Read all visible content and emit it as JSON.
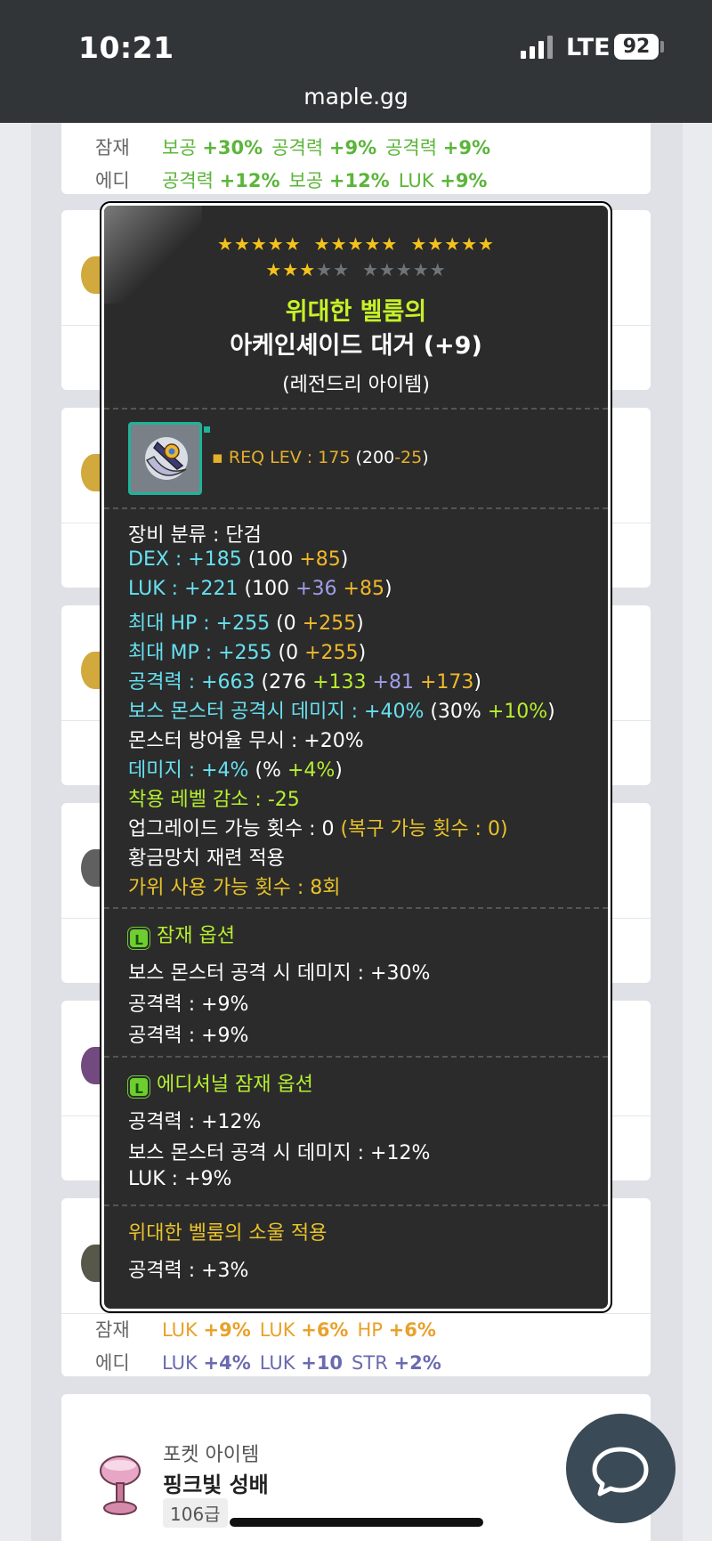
{
  "status": {
    "time": "10:21",
    "network": "LTE",
    "battery": "92"
  },
  "browser": {
    "url": "maple.gg"
  },
  "list": {
    "first_card": {
      "pot_label": "잠재",
      "pot": [
        {
          "k": "보공",
          "v": "+30%"
        },
        {
          "k": "공격력",
          "v": "+9%"
        },
        {
          "k": "공격력",
          "v": "+9%"
        }
      ],
      "add_label": "에디",
      "add": [
        {
          "k": "공격력",
          "v": "+12%"
        },
        {
          "k": "보공",
          "v": "+12%"
        },
        {
          "k": "LUK",
          "v": "+9%"
        }
      ]
    },
    "last_card": {
      "pot_label": "잠재",
      "pot": [
        {
          "k": "LUK",
          "v": "+9%"
        },
        {
          "k": "LUK",
          "v": "+6%"
        },
        {
          "k": "HP",
          "v": "+6%"
        }
      ],
      "add_label": "에디",
      "add": [
        {
          "k": "LUK",
          "v": "+4%"
        },
        {
          "k": "LUK",
          "v": "+10"
        },
        {
          "k": "STR",
          "v": "+2%"
        }
      ]
    },
    "pocket": {
      "category": "포켓 아이템",
      "name": "핑크빛 성배",
      "grade": "106급"
    }
  },
  "tooltip": {
    "stars_filled": 18,
    "stars_total": 25,
    "prefix": "위대한 벨룸의",
    "name": "아케인셰이드 대거 (+9)",
    "grade": "(레전드리 아이템)",
    "req": {
      "label": "▪ REQ LEV : 175 ",
      "open": "(",
      "base": "200",
      "reduce": "-25",
      "close": ")"
    },
    "stats": {
      "category": "장비 분류 : 단검",
      "dex": {
        "label": "DEX : +185",
        "paren_open": " (100 ",
        "add": "+85",
        "paren_close": ")"
      },
      "luk": {
        "label": "LUK : +221",
        "paren_open": " (100 ",
        "scroll": "+36",
        "add": "+85",
        "paren_close": ")"
      },
      "hp": {
        "label": "최대 HP : +255",
        "paren_open": " (0 ",
        "add": "+255",
        "paren_close": ")"
      },
      "mp": {
        "label": "최대 MP : +255",
        "paren_open": " (0 ",
        "add": "+255",
        "paren_close": ")"
      },
      "att": {
        "label": "공격력 : +663",
        "paren_open": " (276 ",
        "star": "+133",
        "scroll": "+81",
        "add": "+173",
        "paren_close": ")"
      },
      "boss": {
        "label": "보스 몬스터 공격시 데미지 : +40%",
        "paren_open": " (30% ",
        "add": "+10%",
        "paren_close": ")"
      },
      "ied": "몬스터 방어율 무시 : +20%",
      "dmg": {
        "label": "데미지 : +4%",
        "paren_open": " (% ",
        "add": "+4%",
        "paren_close": ")"
      },
      "lvl_reduce": "착용 레벨 감소 : -25",
      "upgrade": {
        "label": "업그레이드 가능 횟수 : 0 ",
        "recover": "(복구 가능 횟수 : 0)"
      },
      "hammer": "황금망치 재련 적용",
      "scissors": "가위 사용 가능 횟수 : 8회"
    },
    "potential": {
      "badge": "L",
      "title": "잠재 옵션",
      "lines": [
        "보스 몬스터 공격 시 데미지 : +30%",
        "공격력 : +9%",
        "공격력 : +9%"
      ]
    },
    "additional": {
      "badge": "L",
      "title": "에디셔널 잠재 옵션",
      "lines": [
        "공격력 : +12%",
        "보스 몬스터 공격 시 데미지 : +12%",
        "LUK : +9%"
      ]
    },
    "soul": {
      "title": "위대한 벨룸의 소울 적용",
      "line": "공격력 : +3%"
    }
  },
  "colors": {
    "legendary": "#6dcf2f",
    "star_on": "#f5c21b",
    "prefix": "#c6f227",
    "stat": "#67e0f0"
  },
  "icons": [
    "signal-icon",
    "battery-icon",
    "chat-icon",
    "dagger-item-icon",
    "chalice-item-icon"
  ]
}
